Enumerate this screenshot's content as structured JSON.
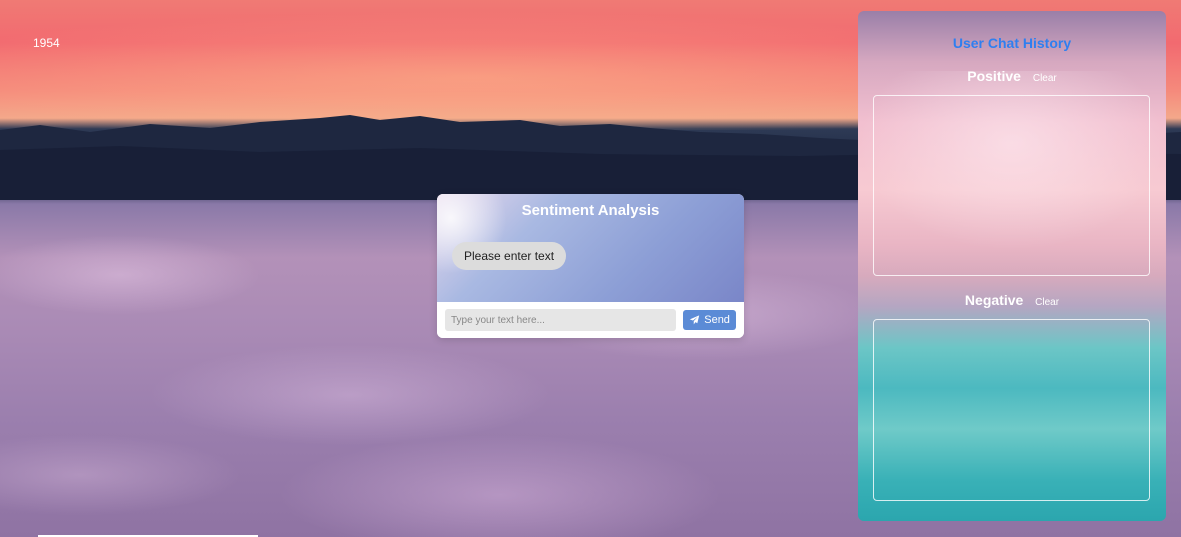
{
  "counter": "1954",
  "chat": {
    "title": "Sentiment Analysis",
    "bot_message": "Please enter text",
    "input_placeholder": "Type your text here...",
    "send_label": "Send",
    "send_icon": "paper-plane-icon"
  },
  "history": {
    "title": "User Chat History",
    "positive_label": "Positive",
    "negative_label": "Negative",
    "clear_label": "Clear",
    "positive_items": [],
    "negative_items": []
  },
  "colors": {
    "accent_blue": "#2f7ff0",
    "send_button": "#5b8bd6"
  }
}
